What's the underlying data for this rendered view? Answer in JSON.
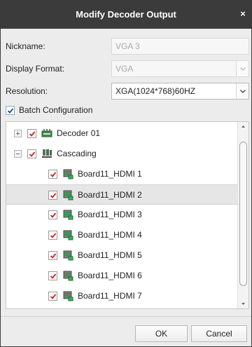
{
  "dialog": {
    "title": "Modify Decoder Output",
    "close_glyph": "×"
  },
  "form": {
    "nickname_label": "Nickname:",
    "nickname_value": "VGA 3",
    "display_format_label": "Display Format:",
    "display_format_value": "VGA",
    "resolution_label": "Resolution:",
    "resolution_value": "XGA(1024*768)60HZ",
    "batch_label": "Batch Configuration",
    "batch_checked": true
  },
  "tree": {
    "items": [
      {
        "label": "Decoder 01",
        "expander": "plus",
        "icon": "decoder-icon",
        "checked": true,
        "selected": false
      },
      {
        "label": "Cascading",
        "expander": "minus",
        "icon": "cascading-icon",
        "checked": true,
        "selected": false
      },
      {
        "label": "Board11_HDMI 1",
        "icon": "board-icon",
        "checked": true,
        "selected": false
      },
      {
        "label": "Board11_HDMI 2",
        "icon": "board-icon",
        "checked": true,
        "selected": true
      },
      {
        "label": "Board11_HDMI 3",
        "icon": "board-icon",
        "checked": true,
        "selected": false
      },
      {
        "label": "Board11_HDMI 4",
        "icon": "board-icon",
        "checked": true,
        "selected": false
      },
      {
        "label": "Board11_HDMI 5",
        "icon": "board-icon",
        "checked": true,
        "selected": false
      },
      {
        "label": "Board11_HDMI 6",
        "icon": "board-icon",
        "checked": true,
        "selected": false
      },
      {
        "label": "Board11_HDMI 7",
        "icon": "board-icon",
        "checked": true,
        "selected": false
      }
    ]
  },
  "buttons": {
    "ok": "OK",
    "cancel": "Cancel"
  },
  "colors": {
    "titlebar": "#3b3b3b",
    "check_red": "#d32222",
    "batch_check_blue": "#1f4f9e",
    "board_green": "#2e9a4e"
  }
}
